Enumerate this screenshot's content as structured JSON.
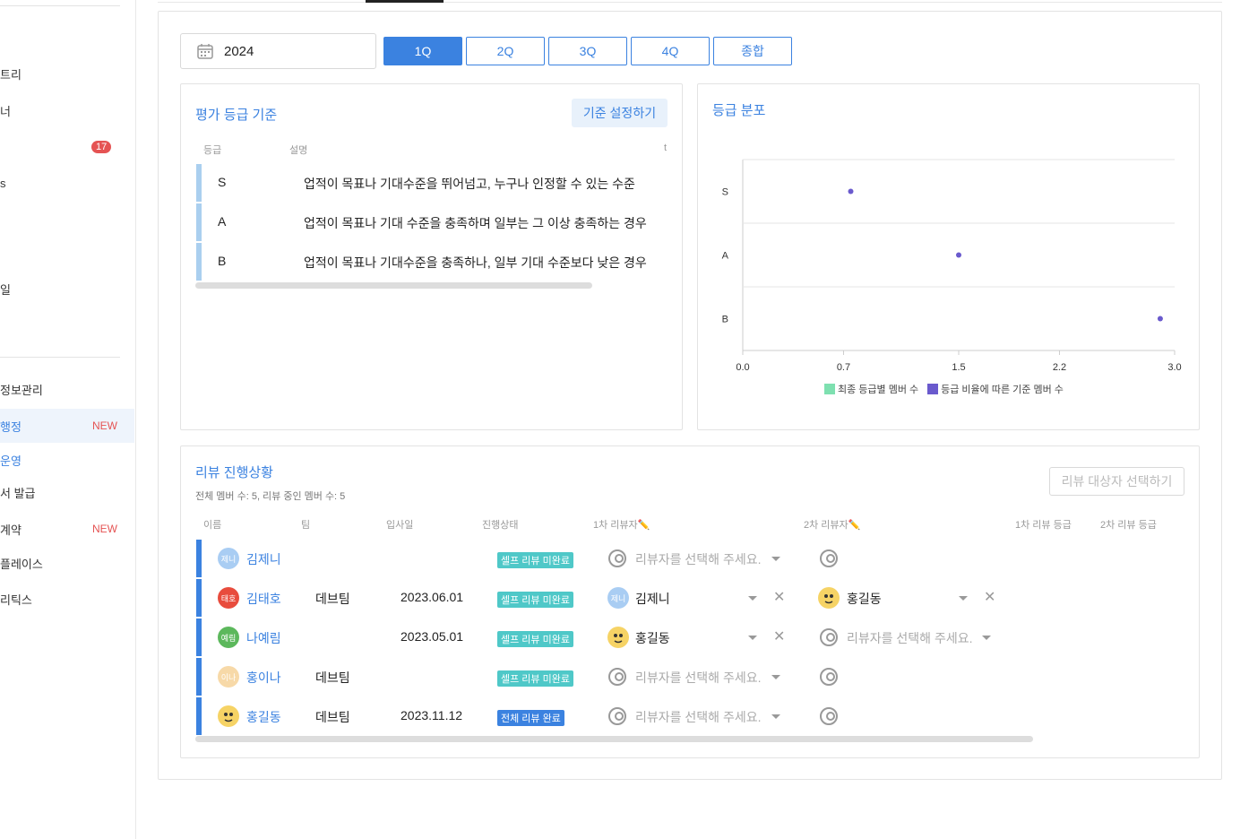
{
  "sidebar": {
    "items": [
      {
        "label": "트리"
      },
      {
        "label": "너"
      },
      {
        "label": "",
        "badge": "17"
      },
      {
        "label": "s"
      },
      {
        "label": "일"
      },
      {
        "label": "정보관리"
      },
      {
        "label": "행정",
        "new": "NEW"
      },
      {
        "label": "운영"
      },
      {
        "label": "서 발급"
      },
      {
        "label": "계약",
        "new": "NEW"
      },
      {
        "label": "플레이스"
      },
      {
        "label": "리틱스"
      }
    ]
  },
  "filter": {
    "year": "2024",
    "quarters": [
      "1Q",
      "2Q",
      "3Q",
      "4Q",
      "종합"
    ],
    "active_quarter": "1Q"
  },
  "criteria": {
    "title": "평가 등급 기준",
    "button": "기준 설정하기",
    "headers": [
      "등급",
      "설명",
      "t"
    ],
    "rows": [
      {
        "grade": "S",
        "desc": "업적이 목표나 기대수준을 뛰어넘고, 누구나 인정할 수 있는 수준"
      },
      {
        "grade": "A",
        "desc": "업적이 목표나 기대 수준을 충족하며 일부는 그 이상 충족하는 경우"
      },
      {
        "grade": "B",
        "desc": "업적이 목표나 기대수준을 충족하나, 일부 기대 수준보다 낮은 경우"
      }
    ]
  },
  "distribution": {
    "title": "등급 분포"
  },
  "chart_data": {
    "type": "scatter",
    "categories": [
      "S",
      "A",
      "B"
    ],
    "xlim": [
      0,
      3.0
    ],
    "xticks": [
      "0.0",
      "0.7",
      "1.5",
      "2.2",
      "3.0"
    ],
    "series": [
      {
        "name": "최종 등급별 멤버 수",
        "color": "#7ee0b0",
        "values": [
          0,
          0,
          0
        ]
      },
      {
        "name": "등급 비율에 따른 기준 멤버 수",
        "color": "#6a5acd",
        "values": [
          0.75,
          1.5,
          2.9
        ]
      }
    ],
    "grid": true,
    "legend": "bottom"
  },
  "review": {
    "title": "리뷰 진행상황",
    "subtitle": "전체 멤버 수: 5, 리뷰 중인 멤버 수: 5",
    "select_button": "리뷰 대상자 선택하기",
    "headers": [
      "이름",
      "팀",
      "입사일",
      "진행상태",
      "1차 리뷰자✏️",
      "2차 리뷰자✏️",
      "1차 리뷰 등급",
      "2차 리뷰 등급"
    ],
    "placeholder": "리뷰자를 선택해 주세요.",
    "rows": [
      {
        "avatar": "제니",
        "avatar_color": "#a9cdf3",
        "name": "김제니",
        "team": "",
        "joined": "",
        "status": "셀프 리뷰 미완료",
        "status_kind": "teal",
        "r1": "",
        "r2": ""
      },
      {
        "avatar": "태호",
        "avatar_color": "#e84c3d",
        "name": "김태호",
        "team": "데브팀",
        "joined": "2023.06.01",
        "status": "셀프 리뷰 미완료",
        "status_kind": "teal",
        "r1": "김제니",
        "r1_avatar": "제니",
        "r2": "홍길동"
      },
      {
        "avatar": "예림",
        "avatar_color": "#5cb85c",
        "name": "나예림",
        "team": "",
        "joined": "2023.05.01",
        "status": "셀프 리뷰 미완료",
        "status_kind": "teal",
        "r1": "홍길동",
        "r2": ""
      },
      {
        "avatar": "이나",
        "avatar_color": "#f7d9a8",
        "name": "홍이나",
        "team": "데브팀",
        "joined": "",
        "status": "셀프 리뷰 미완료",
        "status_kind": "teal",
        "r1": "",
        "r2": ""
      },
      {
        "avatar": "",
        "avatar_color": "#f6d365",
        "name": "홍길동",
        "team": "데브팀",
        "joined": "2023.11.12",
        "status": "전체 리뷰 완료",
        "status_kind": "blue",
        "r1": "",
        "r2": ""
      }
    ]
  }
}
